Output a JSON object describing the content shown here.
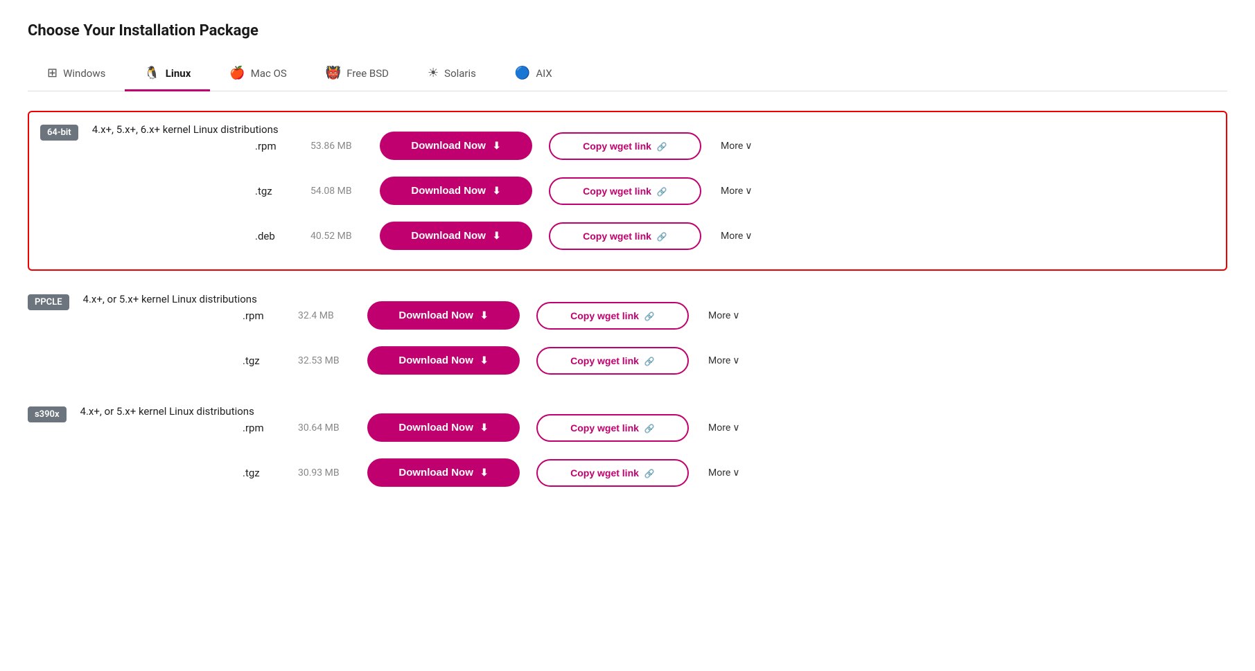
{
  "page": {
    "title": "Choose Your Installation Package"
  },
  "tabs": [
    {
      "id": "windows",
      "label": "Windows",
      "icon": "⊞",
      "active": false
    },
    {
      "id": "linux",
      "label": "Linux",
      "icon": "🐧",
      "active": true
    },
    {
      "id": "macos",
      "label": "Mac OS",
      "icon": "🍎",
      "active": false
    },
    {
      "id": "freebsd",
      "label": "Free BSD",
      "icon": "👹",
      "active": false
    },
    {
      "id": "solaris",
      "label": "Solaris",
      "icon": "☀",
      "active": false
    },
    {
      "id": "aix",
      "label": "AIX",
      "icon": "🔵",
      "active": false
    }
  ],
  "sections": [
    {
      "id": "64bit",
      "arch": "64-bit",
      "desc": "4.x+, 5.x+, 6.x+ kernel Linux distributions",
      "highlighted": true,
      "packages": [
        {
          "ext": ".rpm",
          "size": "53.86 MB"
        },
        {
          "ext": ".tgz",
          "size": "54.08 MB"
        },
        {
          "ext": ".deb",
          "size": "40.52 MB"
        }
      ]
    },
    {
      "id": "ppcle",
      "arch": "PPCLE",
      "desc": "4.x+, or 5.x+ kernel Linux distributions",
      "highlighted": false,
      "packages": [
        {
          "ext": ".rpm",
          "size": "32.4 MB"
        },
        {
          "ext": ".tgz",
          "size": "32.53 MB"
        }
      ]
    },
    {
      "id": "s390x",
      "arch": "s390x",
      "desc": "4.x+, or 5.x+ kernel Linux distributions",
      "highlighted": false,
      "packages": [
        {
          "ext": ".rpm",
          "size": "30.64 MB"
        },
        {
          "ext": ".tgz",
          "size": "30.93 MB"
        }
      ]
    }
  ],
  "labels": {
    "download_now": "Download Now",
    "copy_wget": "Copy wget link",
    "more": "More"
  }
}
